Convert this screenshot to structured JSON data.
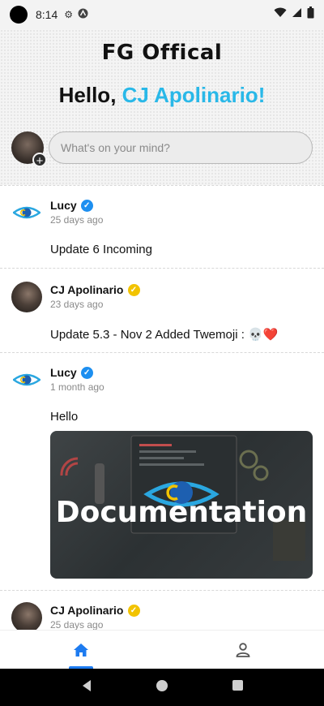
{
  "status_bar": {
    "time": "8:14"
  },
  "header": {
    "app_title": "FG Offical",
    "greeting_prefix": "Hello, ",
    "greeting_name": "CJ Apolinario!",
    "composer_placeholder": "What's on your mind?"
  },
  "posts": [
    {
      "author": "Lucy",
      "verified": "blue",
      "time": "25 days ago",
      "text": "Update 6 Incoming"
    },
    {
      "author": "CJ Apolinario",
      "verified": "gold",
      "time": "23 days ago",
      "text": "Update 5.3 - Nov 2  Added Twemoji : 💀❤️"
    },
    {
      "author": "Lucy",
      "verified": "blue",
      "time": "1 month ago",
      "text": "Hello",
      "image_caption": "Documentation"
    },
    {
      "author": "CJ Apolinario",
      "verified": "gold",
      "time": "25 days ago"
    }
  ],
  "bottom_nav": {
    "active": "home",
    "items": [
      "home",
      "profile"
    ]
  },
  "colors": {
    "accent": "#29b8e8",
    "nav_active": "#1d7bf0",
    "verified_blue": "#1d8ff0",
    "verified_gold": "#f2c300"
  }
}
